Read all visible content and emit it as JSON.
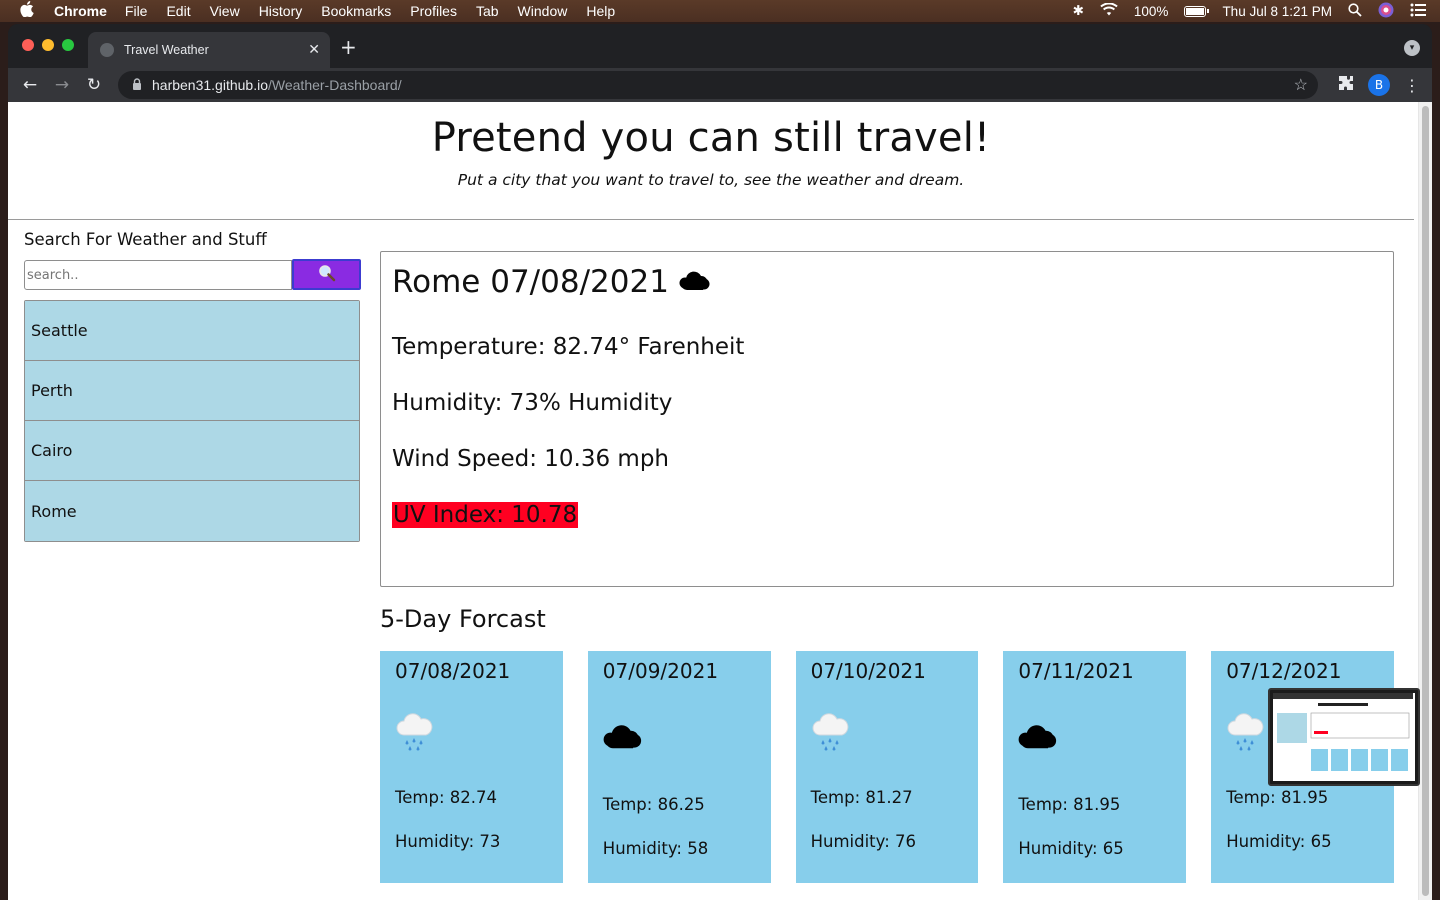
{
  "menubar": {
    "app": "Chrome",
    "items": [
      "File",
      "Edit",
      "View",
      "History",
      "Bookmarks",
      "Profiles",
      "Tab",
      "Window",
      "Help"
    ],
    "battery": "100%",
    "clock": "Thu Jul 8  1:21 PM"
  },
  "browser": {
    "tab_title": "Travel Weather",
    "url_host": "harben31.github.io",
    "url_path": "/Weather-Dashboard/",
    "profile_initial": "B"
  },
  "page": {
    "title": "Pretend you can still travel!",
    "subtitle": "Put a city that you want to travel to, see the weather and dream.",
    "search": {
      "heading": "Search For Weather and Stuff",
      "placeholder": "search..",
      "button_color": "#8a2be2"
    },
    "cities": [
      "Seattle",
      "Perth",
      "Cairo",
      "Rome"
    ],
    "current": {
      "heading": "Rome 07/08/2021",
      "icon": "cloud-icon",
      "temperature": "Temperature: 82.74° Farenheit",
      "humidity": "Humidity: 73% Humidity",
      "wind": "Wind Speed: 10.36 mph",
      "uv": "UV Index: 10.78",
      "uv_color": "#ff0021"
    },
    "forecast_heading": "5-Day Forcast",
    "forecast": [
      {
        "date": "07/08/2021",
        "icon": "rain-cloud-icon",
        "temp": "Temp: 82.74",
        "humidity": "Humidity: 73"
      },
      {
        "date": "07/09/2021",
        "icon": "cloud-icon",
        "temp": "Temp: 86.25",
        "humidity": "Humidity: 58"
      },
      {
        "date": "07/10/2021",
        "icon": "rain-cloud-icon",
        "temp": "Temp: 81.27",
        "humidity": "Humidity: 76"
      },
      {
        "date": "07/11/2021",
        "icon": "cloud-icon",
        "temp": "Temp: 81.95",
        "humidity": "Humidity: 65"
      },
      {
        "date": "07/12/2021",
        "icon": "rain-cloud-icon",
        "temp": "Temp: 81.95",
        "humidity": "Humidity: 65"
      }
    ]
  }
}
